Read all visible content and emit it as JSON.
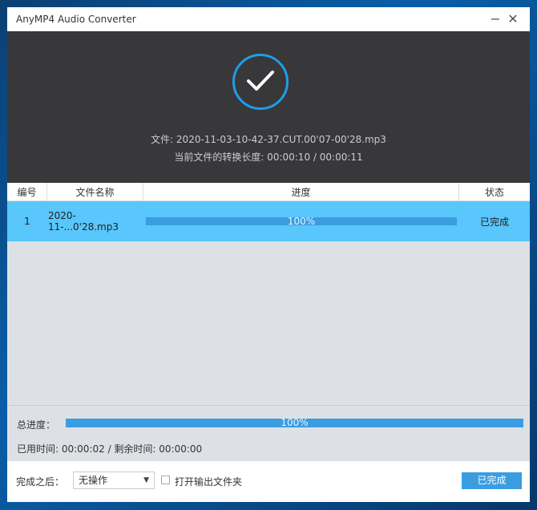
{
  "window": {
    "title": "AnyMP4 Audio Converter",
    "minimize": "−",
    "close": "✕"
  },
  "status": {
    "icon": "check-circle-icon",
    "file_line": "文件: 2020-11-03-10-42-37.CUT.00'07-00'28.mp3",
    "length_line": "当前文件的转换长度: 00:00:10 / 00:00:11"
  },
  "table": {
    "headers": [
      "编号",
      "文件名称",
      "进度",
      "状态"
    ],
    "rows": [
      {
        "index": "1",
        "name": "2020-11-...0'28.mp3",
        "progress": 100,
        "progress_label": "100%",
        "state": "已完成"
      }
    ]
  },
  "total": {
    "label": "总进度：",
    "progress": 100,
    "progress_label": "100%",
    "time_line": "已用时间: 00:00:02 / 剩余时间: 00:00:00"
  },
  "footer": {
    "after_label": "完成之后：",
    "after_value": "无操作",
    "open_folder_label": "打开输出文件夹",
    "open_folder_checked": false,
    "done_button": "已完成"
  },
  "colors": {
    "accent": "#3a9de0",
    "row_selected": "#59c6fc",
    "dark_panel": "#38373a"
  }
}
